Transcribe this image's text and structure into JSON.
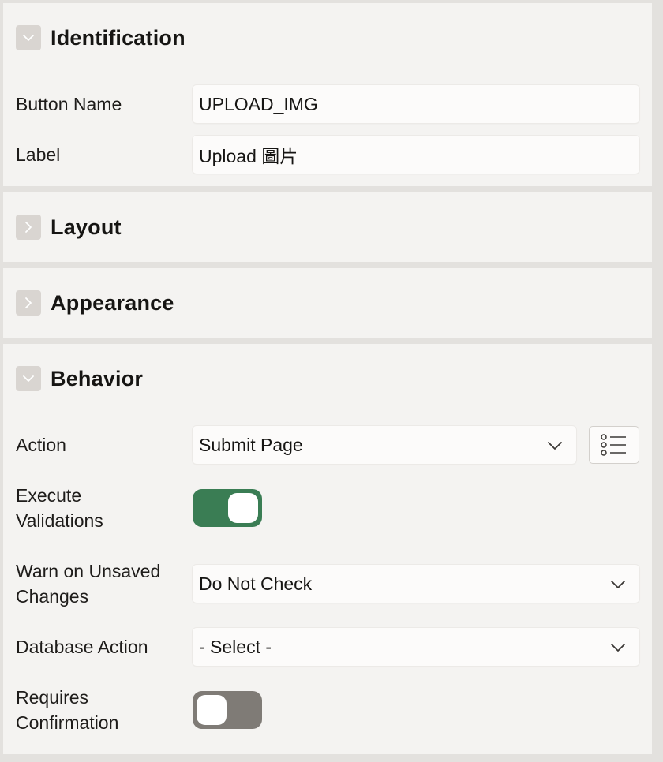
{
  "sections": {
    "identification": {
      "title": "Identification",
      "expanded": true,
      "fields": {
        "button_name": {
          "label": "Button Name",
          "value": "UPLOAD_IMG"
        },
        "label": {
          "label": "Label",
          "value": "Upload 圖片"
        }
      }
    },
    "layout": {
      "title": "Layout",
      "expanded": false
    },
    "appearance": {
      "title": "Appearance",
      "expanded": false
    },
    "behavior": {
      "title": "Behavior",
      "expanded": true,
      "action": {
        "label": "Action",
        "value": "Submit Page",
        "list_icon": "list-icon"
      },
      "execute_validations": {
        "label_line1": "Execute",
        "label_line2": "Validations",
        "on": true
      },
      "warn_unsaved": {
        "label_line1": "Warn on Unsaved",
        "label_line2": "Changes",
        "value": "Do Not Check"
      },
      "database_action": {
        "label": "Database Action",
        "value": "- Select -"
      },
      "requires_confirmation": {
        "label_line1": "Requires",
        "label_line2": "Confirmation",
        "on": false
      }
    }
  },
  "colors": {
    "switch_on": "#3a7d54",
    "switch_off": "#7f7b76",
    "panel_bg": "#f4f3f1",
    "divider": "#e3e1de"
  }
}
